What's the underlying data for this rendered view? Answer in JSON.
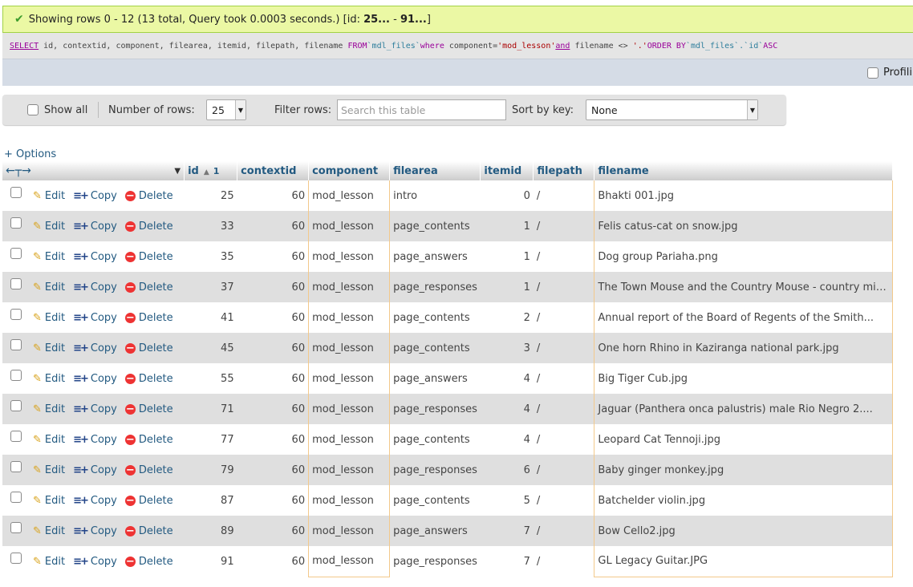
{
  "status": {
    "text_prefix": "Showing rows 0 -  12 (13 total, Query took 0.0003 seconds.) [id: ",
    "range_start": "25...",
    "range_sep": " - ",
    "range_end": "91...",
    "text_suffix": "]"
  },
  "sql": {
    "select": "SELECT",
    "columns": " id, contextid, component, filearea, itemid, filepath, filename ",
    "from": "FROM",
    "table": "`mdl_files`",
    "where": "where",
    "cond1_field": " component=",
    "cond1_value": "'mod_lesson'",
    "and": "and",
    "cond2": " filename <> ",
    "cond2_value": "'.'",
    "order": "ORDER BY",
    "order_field": "`mdl_files`.`id`",
    "dir": "ASC"
  },
  "profiling_label": "Profiling",
  "navbar": {
    "show_all_label": "Show all",
    "num_rows_label": "Number of rows:",
    "num_rows_value": "25",
    "filter_label": "Filter rows:",
    "filter_placeholder": "Search this table",
    "sort_label": "Sort by key:",
    "sort_value": "None"
  },
  "options_label": "+ Options",
  "table": {
    "headers": {
      "id": "id",
      "id_sort_num": "1",
      "contextid": "contextid",
      "component": "component",
      "filearea": "filearea",
      "itemid": "itemid",
      "filepath": "filepath",
      "filename": "filename"
    },
    "actions": {
      "edit": "Edit",
      "copy": "Copy",
      "delete": "Delete"
    },
    "rows": [
      {
        "id": "25",
        "contextid": "60",
        "component": "mod_lesson",
        "filearea": "intro",
        "itemid": "0",
        "filepath": "/",
        "filename": "Bhakti 001.jpg"
      },
      {
        "id": "33",
        "contextid": "60",
        "component": "mod_lesson",
        "filearea": "page_contents",
        "itemid": "1",
        "filepath": "/",
        "filename": "Felis catus-cat on snow.jpg"
      },
      {
        "id": "35",
        "contextid": "60",
        "component": "mod_lesson",
        "filearea": "page_answers",
        "itemid": "1",
        "filepath": "/",
        "filename": "Dog group Pariaha.png"
      },
      {
        "id": "37",
        "contextid": "60",
        "component": "mod_lesson",
        "filearea": "page_responses",
        "itemid": "1",
        "filepath": "/",
        "filename": "The Town Mouse and the Country Mouse - country mic..."
      },
      {
        "id": "41",
        "contextid": "60",
        "component": "mod_lesson",
        "filearea": "page_contents",
        "itemid": "2",
        "filepath": "/",
        "filename": "Annual report of the Board of Regents of the Smith..."
      },
      {
        "id": "45",
        "contextid": "60",
        "component": "mod_lesson",
        "filearea": "page_contents",
        "itemid": "3",
        "filepath": "/",
        "filename": "One horn Rhino in Kaziranga national park.jpg"
      },
      {
        "id": "55",
        "contextid": "60",
        "component": "mod_lesson",
        "filearea": "page_answers",
        "itemid": "4",
        "filepath": "/",
        "filename": "Big Tiger Cub.jpg"
      },
      {
        "id": "71",
        "contextid": "60",
        "component": "mod_lesson",
        "filearea": "page_responses",
        "itemid": "4",
        "filepath": "/",
        "filename": "Jaguar (Panthera onca palustris) male Rio Negro 2...."
      },
      {
        "id": "77",
        "contextid": "60",
        "component": "mod_lesson",
        "filearea": "page_contents",
        "itemid": "4",
        "filepath": "/",
        "filename": "Leopard Cat Tennoji.jpg"
      },
      {
        "id": "79",
        "contextid": "60",
        "component": "mod_lesson",
        "filearea": "page_responses",
        "itemid": "6",
        "filepath": "/",
        "filename": "Baby ginger monkey.jpg"
      },
      {
        "id": "87",
        "contextid": "60",
        "component": "mod_lesson",
        "filearea": "page_contents",
        "itemid": "5",
        "filepath": "/",
        "filename": "Batchelder violin.jpg"
      },
      {
        "id": "89",
        "contextid": "60",
        "component": "mod_lesson",
        "filearea": "page_answers",
        "itemid": "7",
        "filepath": "/",
        "filename": "Bow Cello2.jpg"
      },
      {
        "id": "91",
        "contextid": "60",
        "component": "mod_lesson",
        "filearea": "page_responses",
        "itemid": "7",
        "filepath": "/",
        "filename": "GL Legacy Guitar.JPG"
      }
    ]
  }
}
